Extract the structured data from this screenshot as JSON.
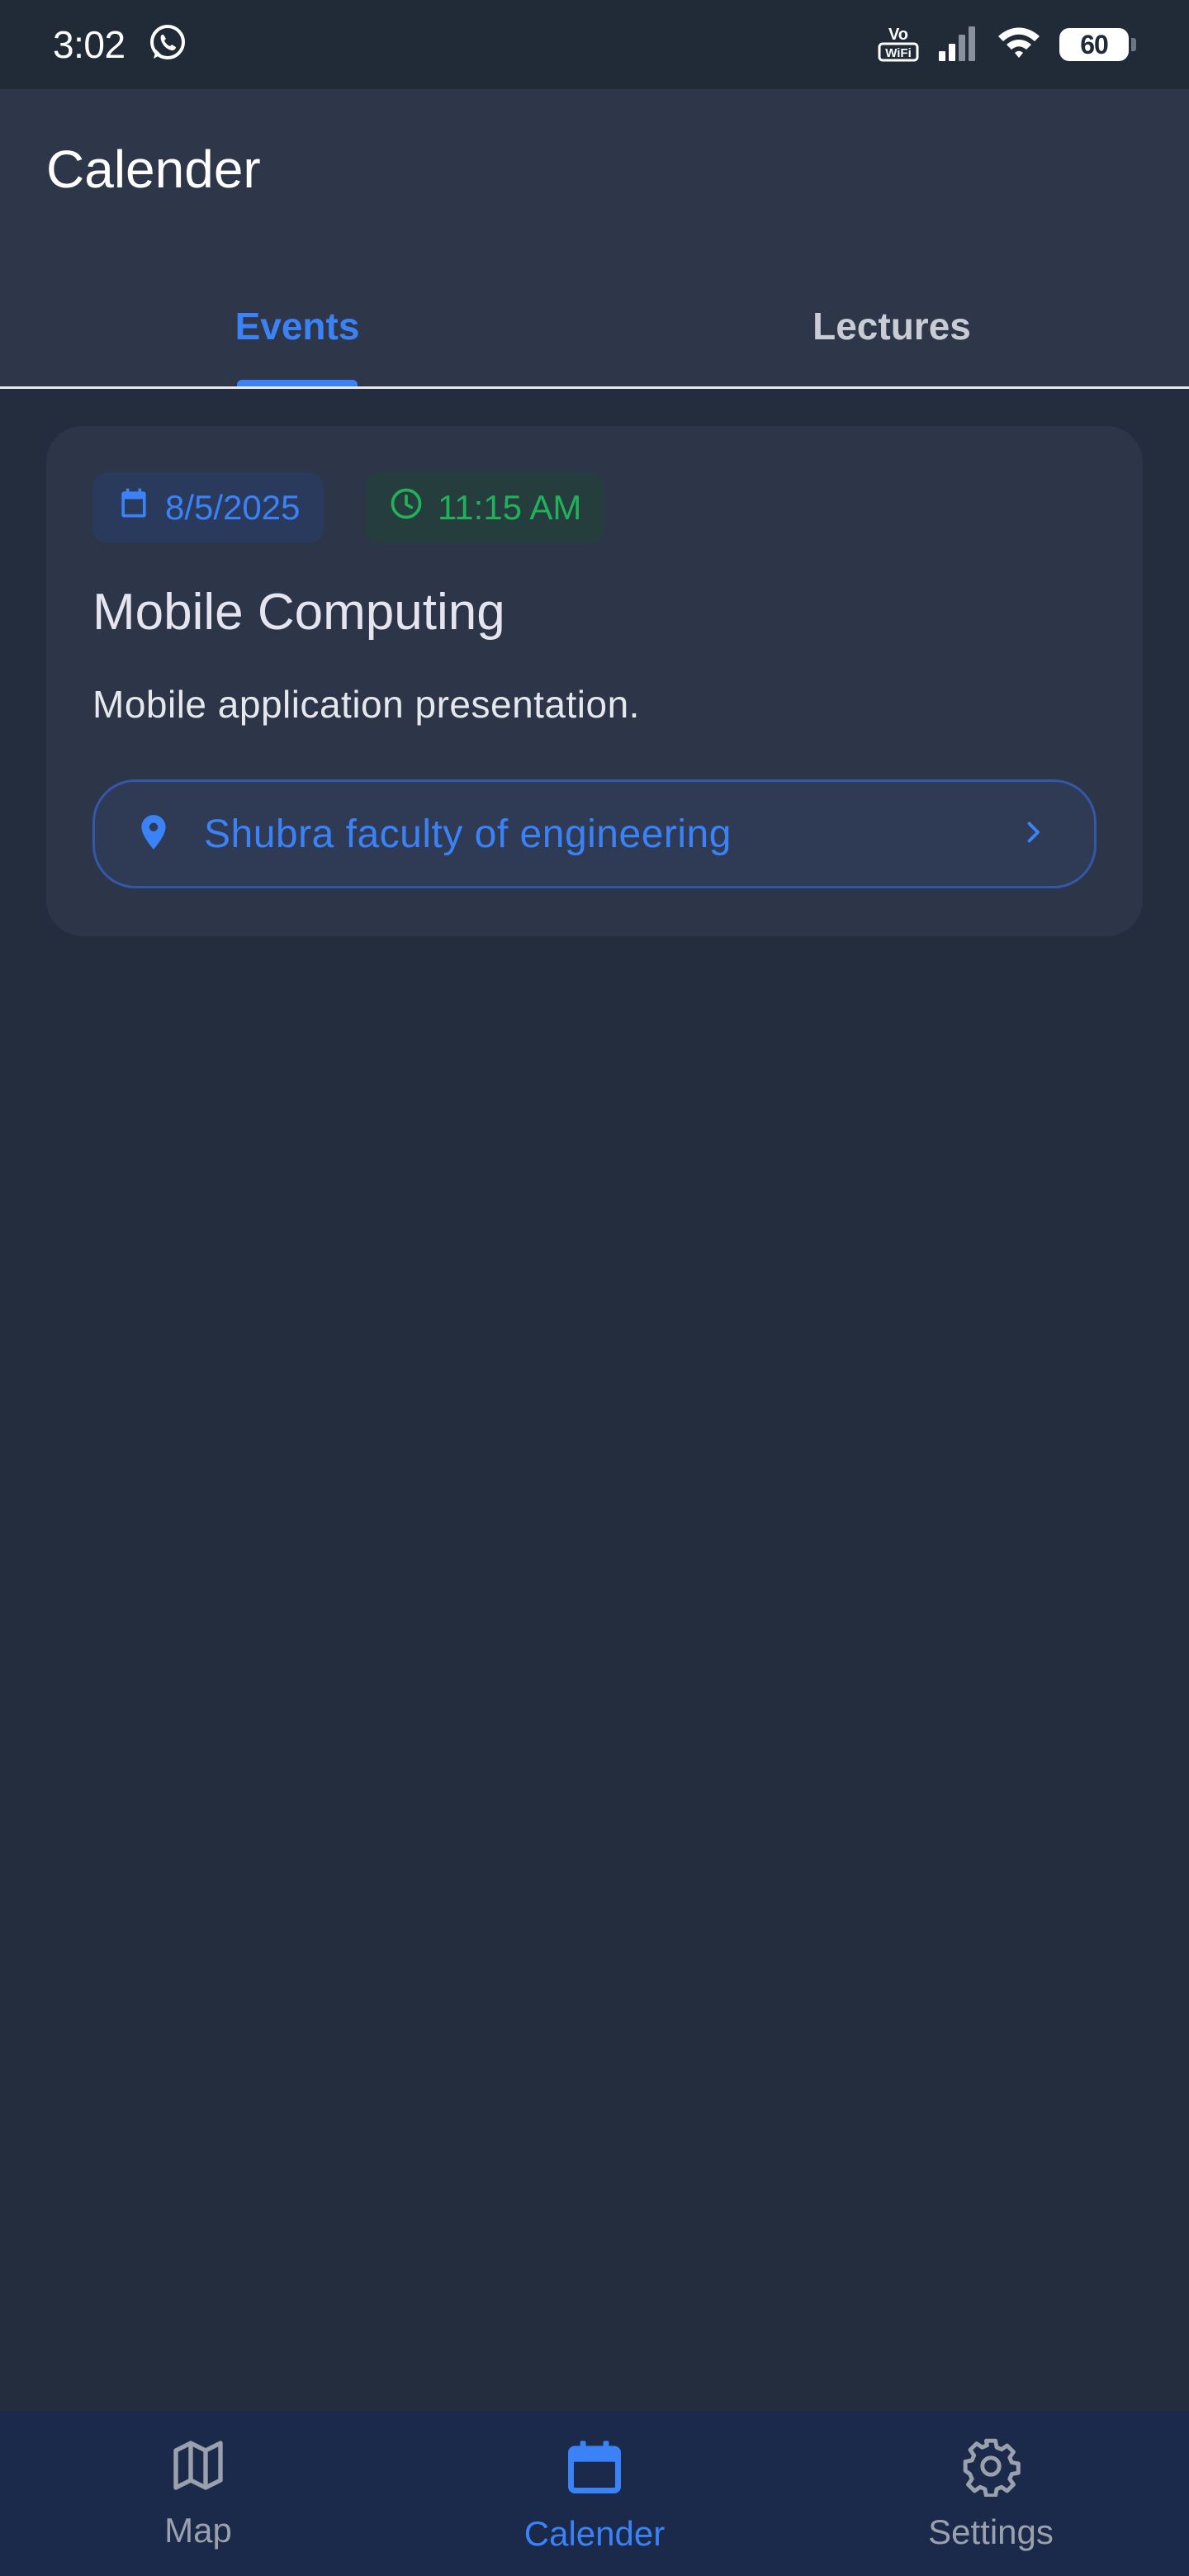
{
  "status_bar": {
    "time": "3:02",
    "notification_icon": "whatsapp-icon",
    "vowifi": "Vo WiFi",
    "battery": "60"
  },
  "app_bar": {
    "title": "Calender",
    "tabs": [
      {
        "label": "Events",
        "active": true
      },
      {
        "label": "Lectures",
        "active": false
      }
    ]
  },
  "events": [
    {
      "date": "8/5/2025",
      "time": "11:15 AM",
      "title": "Mobile Computing",
      "description": "Mobile application presentation.",
      "location": "Shubra faculty of engineering"
    }
  ],
  "bottom_nav": {
    "items": [
      {
        "label": "Map",
        "icon": "map-icon",
        "active": false
      },
      {
        "label": "Calender",
        "icon": "calendar-icon",
        "active": true
      },
      {
        "label": "Settings",
        "icon": "settings-icon",
        "active": false
      }
    ]
  },
  "colors": {
    "accent": "#3b82f6",
    "time_chip": "#22b15a",
    "background": "#232d3d",
    "card": "#2d3648",
    "nav": "#1b2a4a"
  }
}
